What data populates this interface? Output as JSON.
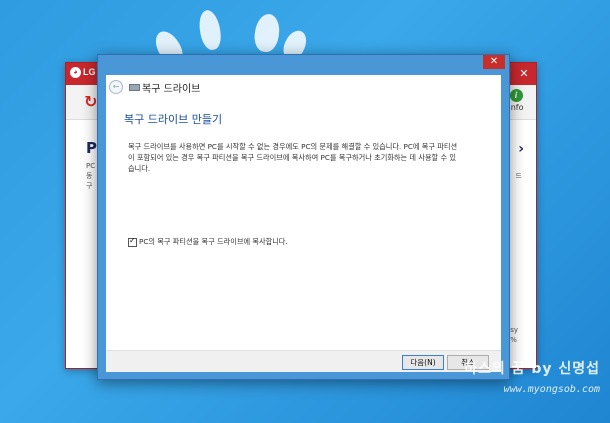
{
  "lg_window": {
    "logo": "LG",
    "close_icon": "close-icon",
    "refresh_icon": "refresh-icon",
    "info_label": "info",
    "main_title": "PC",
    "main_text_lines": [
      "PC",
      "동",
      "구"
    ],
    "right_text_lines": [
      "드"
    ],
    "bottom_right_lines": [
      "sy",
      "%"
    ]
  },
  "dialog": {
    "title": "복구 드라이브",
    "heading": "복구 드라이브 만들기",
    "description": "복구 드라이브를 사용하면 PC를 시작할 수 없는 경우에도 PC의 문제를 해결할 수 있습니다. PC에 복구 파티션이 포함되어 있는 경우 복구 파티션을 복구 드라이브에 복사하여 PC를 복구하거나 초기화하는 데 사용할 수 있습니다.",
    "checkbox_label": "PC의 복구 파티션을 복구 드라이브에 복사합니다.",
    "checkbox_checked": true,
    "next_button": "다음(N)",
    "cancel_button": "취소",
    "close_label": "✕"
  },
  "watermark": {
    "title": "하스의 꿈 by 신명섭",
    "url": "www.myongsob.com"
  }
}
